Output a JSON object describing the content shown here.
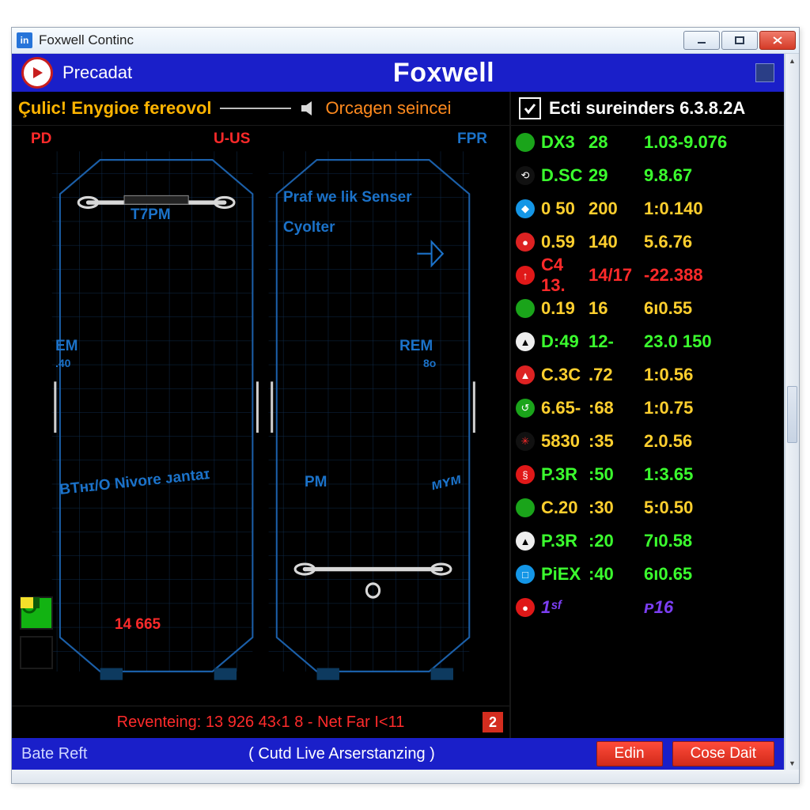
{
  "window": {
    "app_icon_text": "in",
    "title": "Foxwell Continc"
  },
  "brandbar": {
    "breadcrumb": "Precadat",
    "logo": "Foxwell"
  },
  "diagram": {
    "warn_left": "Çulic!  Enygioe fereovol",
    "warn_right": "Orcagen seincei",
    "labels": {
      "pd": "PD",
      "uus": "U-US",
      "fpr": "FPR",
      "t7pm": "T7PM",
      "praf": "Praf we lik   Senser",
      "cyolter": "Cyolter",
      "em": "EM",
      "em_sub": ".40",
      "rem": "REM",
      "rem_sub": "8o",
      "btnivore": "BTʜɪ/O Nivore ᴊantaɪ",
      "pm": "PM",
      "mvm": "ᴍʏᴍ",
      "bottom_num": "14 665"
    },
    "status_line": "Reventeing:  13 926 43‹1 8 - Net Far I<11",
    "status_badge": "2"
  },
  "sidebar": {
    "title": "Ecti sureinders 6.3.8.2A",
    "rows": [
      {
        "icon_bg": "#1aa41a",
        "c1": "DX3",
        "c2": "28",
        "c3": "1.03-9.076",
        "color": "#3bff2e"
      },
      {
        "icon_bg": "#111",
        "icon_txt": "⟲",
        "c1": "D.SC",
        "c2": "29",
        "c3": "9.8.67",
        "color": "#3bff2e"
      },
      {
        "icon_bg": "#1496e6",
        "icon_txt": "◆",
        "c1": "0 50",
        "c2": "200",
        "c3": "1:0.140",
        "color": "#ffcf2e"
      },
      {
        "icon_bg": "#d22",
        "icon_txt": "●",
        "c1": "0.59",
        "c2": "140",
        "c3": "5.6.76",
        "color": "#ffcf2e"
      },
      {
        "icon_bg": "#e01818",
        "icon_txt": "↑",
        "c1": "C4 13.",
        "c2": "14/17",
        "c3": "-22.388",
        "color": "#ff2a2a"
      },
      {
        "icon_bg": "#1aa41a",
        "c1": "0.19",
        "c2": "16",
        "c3": "6ı0.55",
        "color": "#ffcf2e"
      },
      {
        "icon_bg": "#eee",
        "icon_txt": "▲",
        "icon_fg": "#000",
        "c1": "D:49",
        "c2": "12-",
        "c3": "23.0 150",
        "color": "#3bff2e"
      },
      {
        "icon_bg": "#d22",
        "icon_txt": "▲",
        "c1": "C.3C",
        "c2": ".72",
        "c3": "1:0.56",
        "color": "#ffcf2e"
      },
      {
        "icon_bg": "#1aa41a",
        "icon_txt": "↺",
        "c1": "6.65-",
        "c2": ":68",
        "c3": "1:0.75",
        "color": "#ffcf2e"
      },
      {
        "icon_bg": "#111",
        "icon_txt": "✳",
        "icon_fg": "#ff2a2a",
        "c1": "5830",
        "c2": ":35",
        "c3": "2.0.56",
        "color": "#ffcf2e"
      },
      {
        "icon_bg": "#e01818",
        "icon_txt": "§",
        "c1": "P.3R",
        "c2": ":50",
        "c3": "1:3.65",
        "color": "#3bff2e"
      },
      {
        "icon_bg": "#1aa41a",
        "c1": "C.20",
        "c2": ":30",
        "c3": "5:0.50",
        "color": "#ffcf2e"
      },
      {
        "icon_bg": "#eee",
        "icon_txt": "▲",
        "icon_fg": "#000",
        "c1": "P.3R",
        "c2": ":20",
        "c3": "7ı0.58",
        "color": "#3bff2e"
      },
      {
        "icon_bg": "#1496e6",
        "icon_txt": "□",
        "c1": "PiEX",
        "c2": ":40",
        "c3": "6ı0.65",
        "color": "#3bff2e"
      },
      {
        "icon_bg": "#e01818",
        "icon_txt": "●",
        "c1": "1ˢᶠ",
        "c2": "",
        "c3": "ᴘ16",
        "color": "#7b3ef2",
        "purple": true
      }
    ]
  },
  "footer": {
    "left": "Bate Reft",
    "center": "( Cutd Live Arserstanzing )",
    "btn_edit": "Edin",
    "btn_close": "Cose Dait"
  }
}
